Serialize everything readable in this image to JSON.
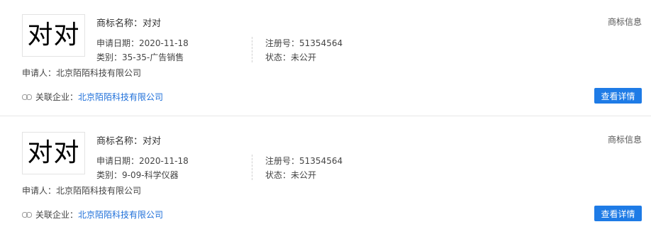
{
  "records": [
    {
      "logo_text": "对对",
      "name_label": "商标名称：",
      "name_value": "对对",
      "date_label": "申请日期：",
      "date_value": "2020-11-18",
      "category_label": "类别：",
      "category_value": "35-35-广告销售",
      "reg_label": "注册号：",
      "reg_value": "51354564",
      "status_label": "状态：",
      "status_value": "未公开",
      "applicant_label": "申请人：",
      "applicant_value": "北京陌陌科技有限公司",
      "info_tag": "商标信息",
      "related_label": "关联企业：",
      "related_link": "北京陌陌科技有限公司",
      "detail_button": "查看详情"
    },
    {
      "logo_text": "对对",
      "name_label": "商标名称：",
      "name_value": "对对",
      "date_label": "申请日期：",
      "date_value": "2020-11-18",
      "category_label": "类别：",
      "category_value": "9-09-科学仪器",
      "reg_label": "注册号：",
      "reg_value": "51354564",
      "status_label": "状态：",
      "status_value": "未公开",
      "applicant_label": "申请人：",
      "applicant_value": "北京陌陌科技有限公司",
      "info_tag": "商标信息",
      "related_label": "关联企业：",
      "related_link": "北京陌陌科技有限公司",
      "detail_button": "查看详情"
    }
  ],
  "colors": {
    "link": "#1e6fd9",
    "button": "#1e7be6",
    "divider": "#e8e8e8"
  },
  "icons": {
    "related": "link-icon"
  }
}
